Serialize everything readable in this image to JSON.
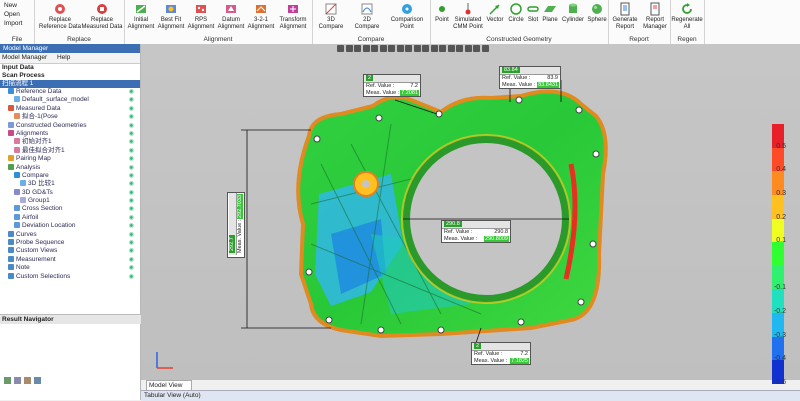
{
  "ribbon": {
    "file": {
      "group": "File",
      "items": [
        "New",
        "Open",
        "Import"
      ]
    },
    "replace": {
      "group": "Replace",
      "buttons": [
        "Replace\nReference Data",
        "Replace\nMeasured Data"
      ]
    },
    "alignment": {
      "group": "Alignment",
      "buttons": [
        "Initial\nAlignment",
        "Best Fit\nAlignment",
        "RPS\nAlignment",
        "Datum\nAlignment",
        "3-2-1\nAlignment",
        "Transform\nAlignment"
      ]
    },
    "compare": {
      "group": "Compare",
      "buttons": [
        "3D\nCompare",
        "2D\nCompare",
        "Comparison\nPoint"
      ]
    },
    "constructed": {
      "group": "Constructed Geometry",
      "buttons": [
        "Point",
        "Simulated\nCMM Point",
        "Vector",
        "Circle",
        "Slot",
        "Plane",
        "Cylinder",
        "Sphere"
      ]
    },
    "report": {
      "group": "Report",
      "buttons": [
        "Generate\nReport",
        "Report\nManager"
      ]
    },
    "regen": {
      "group": "Regen",
      "buttons": [
        "Regenerate\nAll"
      ]
    }
  },
  "left_panel": {
    "title": "Model Manager",
    "tabs": [
      "Model Manager",
      "Help"
    ],
    "sections": [
      "Input Data",
      "Scan Process"
    ],
    "scan_process_item": "扫描流程 1",
    "tree": [
      {
        "label": "Reference Data",
        "indent": 1,
        "color": "#3a8fd8"
      },
      {
        "label": "Default_surface_model",
        "indent": 2,
        "color": "#6ab0e8"
      },
      {
        "label": "Measured Data",
        "indent": 1,
        "color": "#d85a3a"
      },
      {
        "label": "拟合-1(Pose",
        "indent": 2,
        "color": "#e88a5a"
      },
      {
        "label": "Constructed Geometries",
        "indent": 1,
        "color": "#7b9bd6"
      },
      {
        "label": "Alignments",
        "indent": 1,
        "color": "#c84a8a"
      },
      {
        "label": "初始对齐1",
        "indent": 2,
        "color": "#d87aa0"
      },
      {
        "label": "最佳拟合对齐1",
        "indent": 2,
        "color": "#d87aa0"
      },
      {
        "label": "Pairing Map",
        "indent": 1,
        "color": "#e0a030"
      },
      {
        "label": "Analysis",
        "indent": 1,
        "color": "#50a050"
      },
      {
        "label": "Compare",
        "indent": 2,
        "color": "#2c8fd8"
      },
      {
        "label": "3D 比较1",
        "indent": 3,
        "color": "#6ab0e8"
      },
      {
        "label": "3D GD&Ts",
        "indent": 2,
        "color": "#8888cc"
      },
      {
        "label": "Group1",
        "indent": 3,
        "color": "#aaaadd"
      },
      {
        "label": "Cross Section",
        "indent": 2,
        "color": "#5a9ad8"
      },
      {
        "label": "Airfoil",
        "indent": 2,
        "color": "#5a9ad8"
      },
      {
        "label": "Deviation Location",
        "indent": 2,
        "color": "#5a9ad8"
      },
      {
        "label": "Curves",
        "indent": 1,
        "color": "#4a8ac8"
      },
      {
        "label": "Probe Sequence",
        "indent": 1,
        "color": "#4a8ac8"
      },
      {
        "label": "Custom Views",
        "indent": 1,
        "color": "#4a8ac8"
      },
      {
        "label": "Measurement",
        "indent": 1,
        "color": "#4a8ac8"
      },
      {
        "label": "Note",
        "indent": 1,
        "color": "#4a8ac8"
      },
      {
        "label": "Custom Selections",
        "indent": 1,
        "color": "#4a8ac8"
      }
    ],
    "result_navigator": "Result Navigator"
  },
  "viewport": {
    "model_view_tab": "Model View",
    "tabular_view": "Tabular View (Auto)",
    "callouts": [
      {
        "id": "top-left",
        "head": "2",
        "ref_label": "Ref. Value :",
        "ref_val": "7.2",
        "meas_label": "Meas. Value :",
        "meas_val": "7.2081"
      },
      {
        "id": "top-right",
        "head": "83.84",
        "ref_label": "Ref. Value :",
        "ref_val": "83.9",
        "meas_label": "Meas. Value :",
        "meas_val": "83.8431"
      },
      {
        "id": "left-dim",
        "head": "292.7",
        "ref_label": "Ref. Value :",
        "ref_val": "292",
        "meas_label": "Meas. Value :",
        "meas_val": "292.7033"
      },
      {
        "id": "center",
        "head": "290.8",
        "ref_label": "Ref. Value :",
        "ref_val": "290.8",
        "meas_label": "Meas. Value :",
        "meas_val": "290.8009"
      },
      {
        "id": "bottom",
        "head": "2",
        "ref_label": "Ref. Value :",
        "ref_val": "7.2",
        "meas_label": "Meas. Value :",
        "meas_val": "7.1825"
      }
    ]
  },
  "color_scale": {
    "labels": [
      "0.5",
      "0.4",
      "0.3",
      "0.2",
      "0.1",
      "-0.1",
      "-0.2",
      "-0.3",
      "-0.4",
      "-0.5"
    ],
    "colors": [
      "#e8202a",
      "#ff4a28",
      "#ff8a20",
      "#ffc020",
      "#f0ff20",
      "#30ff30",
      "#30f070",
      "#20e0c0",
      "#20b8f0",
      "#2070f0",
      "#1030d0"
    ]
  }
}
